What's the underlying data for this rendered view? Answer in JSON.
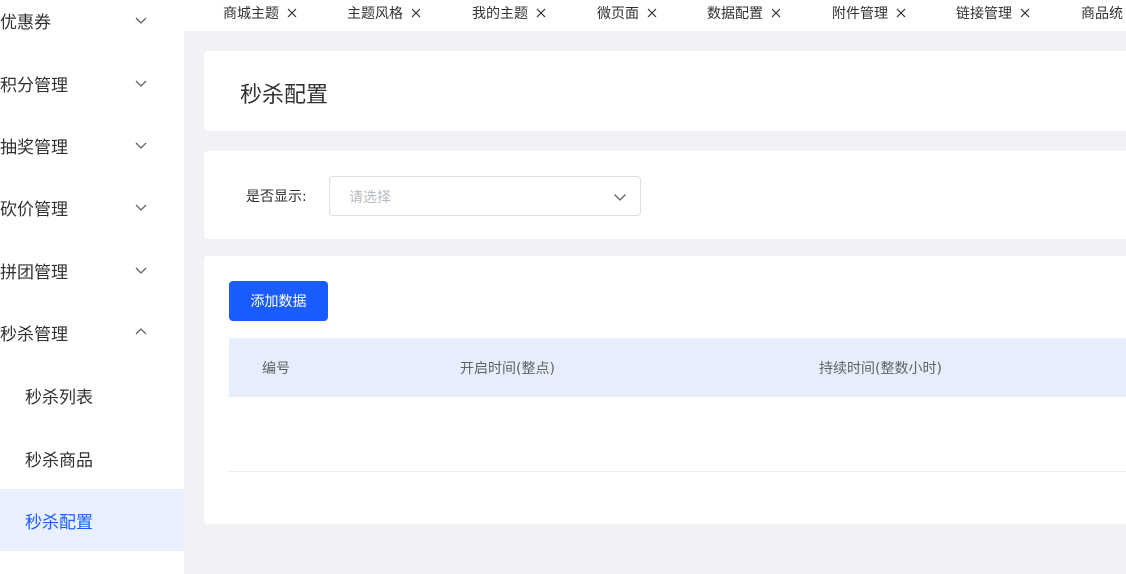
{
  "sidebar": {
    "menus": [
      {
        "label": "优惠券",
        "expanded": false
      },
      {
        "label": "积分管理",
        "expanded": false
      },
      {
        "label": "抽奖管理",
        "expanded": false
      },
      {
        "label": "砍价管理",
        "expanded": false
      },
      {
        "label": "拼团管理",
        "expanded": false
      },
      {
        "label": "秒杀管理",
        "expanded": true
      }
    ],
    "submenus": [
      {
        "label": "秒杀列表"
      },
      {
        "label": "秒杀商品"
      },
      {
        "label": "秒杀配置",
        "active": true
      }
    ],
    "active_color": "#1a5cff"
  },
  "tabs": [
    {
      "label": "商城主题"
    },
    {
      "label": "主题风格"
    },
    {
      "label": "我的主题"
    },
    {
      "label": "微页面"
    },
    {
      "label": "数据配置"
    },
    {
      "label": "附件管理"
    },
    {
      "label": "链接管理"
    },
    {
      "label": "商品统"
    }
  ],
  "page": {
    "title": "秒杀配置"
  },
  "filter": {
    "label": "是否显示:",
    "placeholder": "请选择"
  },
  "table": {
    "add_button": "添加数据",
    "columns": [
      "编号",
      "开启时间(整点)",
      "持续时间(整数小时)"
    ]
  }
}
